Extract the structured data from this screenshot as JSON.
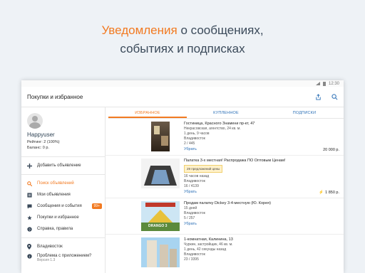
{
  "promo": {
    "accent": "Уведомления",
    "line1_rest": " о сообщениях,",
    "line2": "событиях и подписках"
  },
  "statusbar": {
    "time": "12:30"
  },
  "appbar": {
    "title": "Покупки и избранное"
  },
  "profile": {
    "username": "Happyuser",
    "rating": "Рейтинг: 2 (100%)",
    "balance": "Баланс: 0 р."
  },
  "menu": {
    "add": "Добавить объявление",
    "search": "Поиск объявлений",
    "my_ads": "Мои объявления",
    "messages": "Сообщения и события",
    "messages_badge": "99+",
    "purchases": "Покупки и избранное",
    "help": "Справка, правила",
    "city": "Владивосток",
    "problem": "Проблема с приложением?",
    "version": "Версия 1.3"
  },
  "tabs": [
    "ИЗБРАННОЕ",
    "КУПЛЕННОЕ",
    "ПОДПИСКИ"
  ],
  "listings": [
    {
      "title": "Гостиница, Красного Знамени пр-кт, 47",
      "sub": "Некрасовская, агентство, 24 кв. м.",
      "time": "1 день, 9 часов",
      "city": "Владивосток",
      "views": "2 / 445",
      "action": "Убрать",
      "price": "20 000 р."
    },
    {
      "title": "Палатка 3-х местная! Распродажа ПО Оптовым Ценам!",
      "offer": "29 предложений цены",
      "time": "16 часов назад",
      "city": "Владивосток",
      "views": "16 / 4139",
      "action": "Убрать",
      "price": "1 850 р."
    },
    {
      "title": "Продам палатку Dickey 3-4-местную (Ю. Корея)",
      "time": "15 дней",
      "city": "Владивосток",
      "views": "5 / 257",
      "action": "Убрать",
      "price": "",
      "thumb_label": "DRANGO 3"
    },
    {
      "title": "1-комнатная, Калинина, 13",
      "sub": "Чуркин, застройщик, 46 кв. м.",
      "time": "1 день, 42 секунды назад",
      "city": "Владивосток",
      "views": "23 / 3395",
      "action": "",
      "price": ""
    }
  ],
  "colors": {
    "accent": "#f27a21",
    "link": "#2a6fb6"
  }
}
